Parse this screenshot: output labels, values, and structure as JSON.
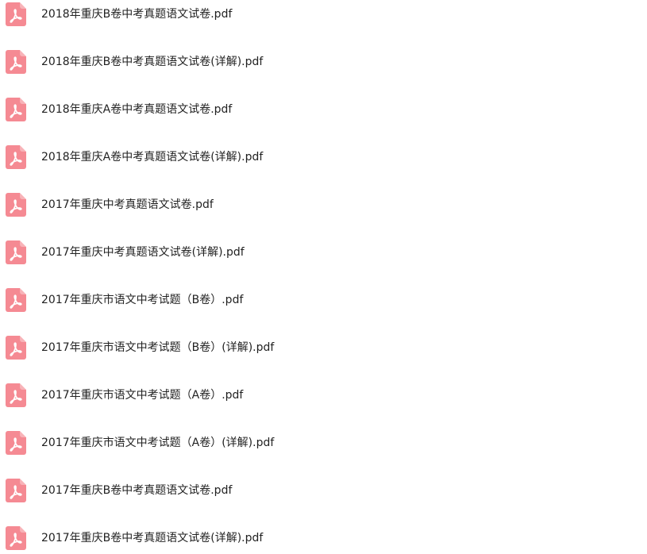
{
  "file_icon": {
    "name": "pdf-file-icon",
    "color": "#f58a93",
    "glyph_color": "#ffffff"
  },
  "files": [
    {
      "name": "2018年重庆B卷中考真题语文试卷.pdf"
    },
    {
      "name": "2018年重庆B卷中考真题语文试卷(详解).pdf"
    },
    {
      "name": "2018年重庆A卷中考真题语文试卷.pdf"
    },
    {
      "name": "2018年重庆A卷中考真题语文试卷(详解).pdf"
    },
    {
      "name": "2017年重庆中考真题语文试卷.pdf"
    },
    {
      "name": "2017年重庆中考真题语文试卷(详解).pdf"
    },
    {
      "name": "2017年重庆市语文中考试题（B卷）.pdf"
    },
    {
      "name": "2017年重庆市语文中考试题（B卷）(详解).pdf"
    },
    {
      "name": "2017年重庆市语文中考试题（A卷）.pdf"
    },
    {
      "name": "2017年重庆市语文中考试题（A卷）(详解).pdf"
    },
    {
      "name": "2017年重庆B卷中考真题语文试卷.pdf"
    },
    {
      "name": "2017年重庆B卷中考真题语文试卷(详解).pdf"
    }
  ]
}
